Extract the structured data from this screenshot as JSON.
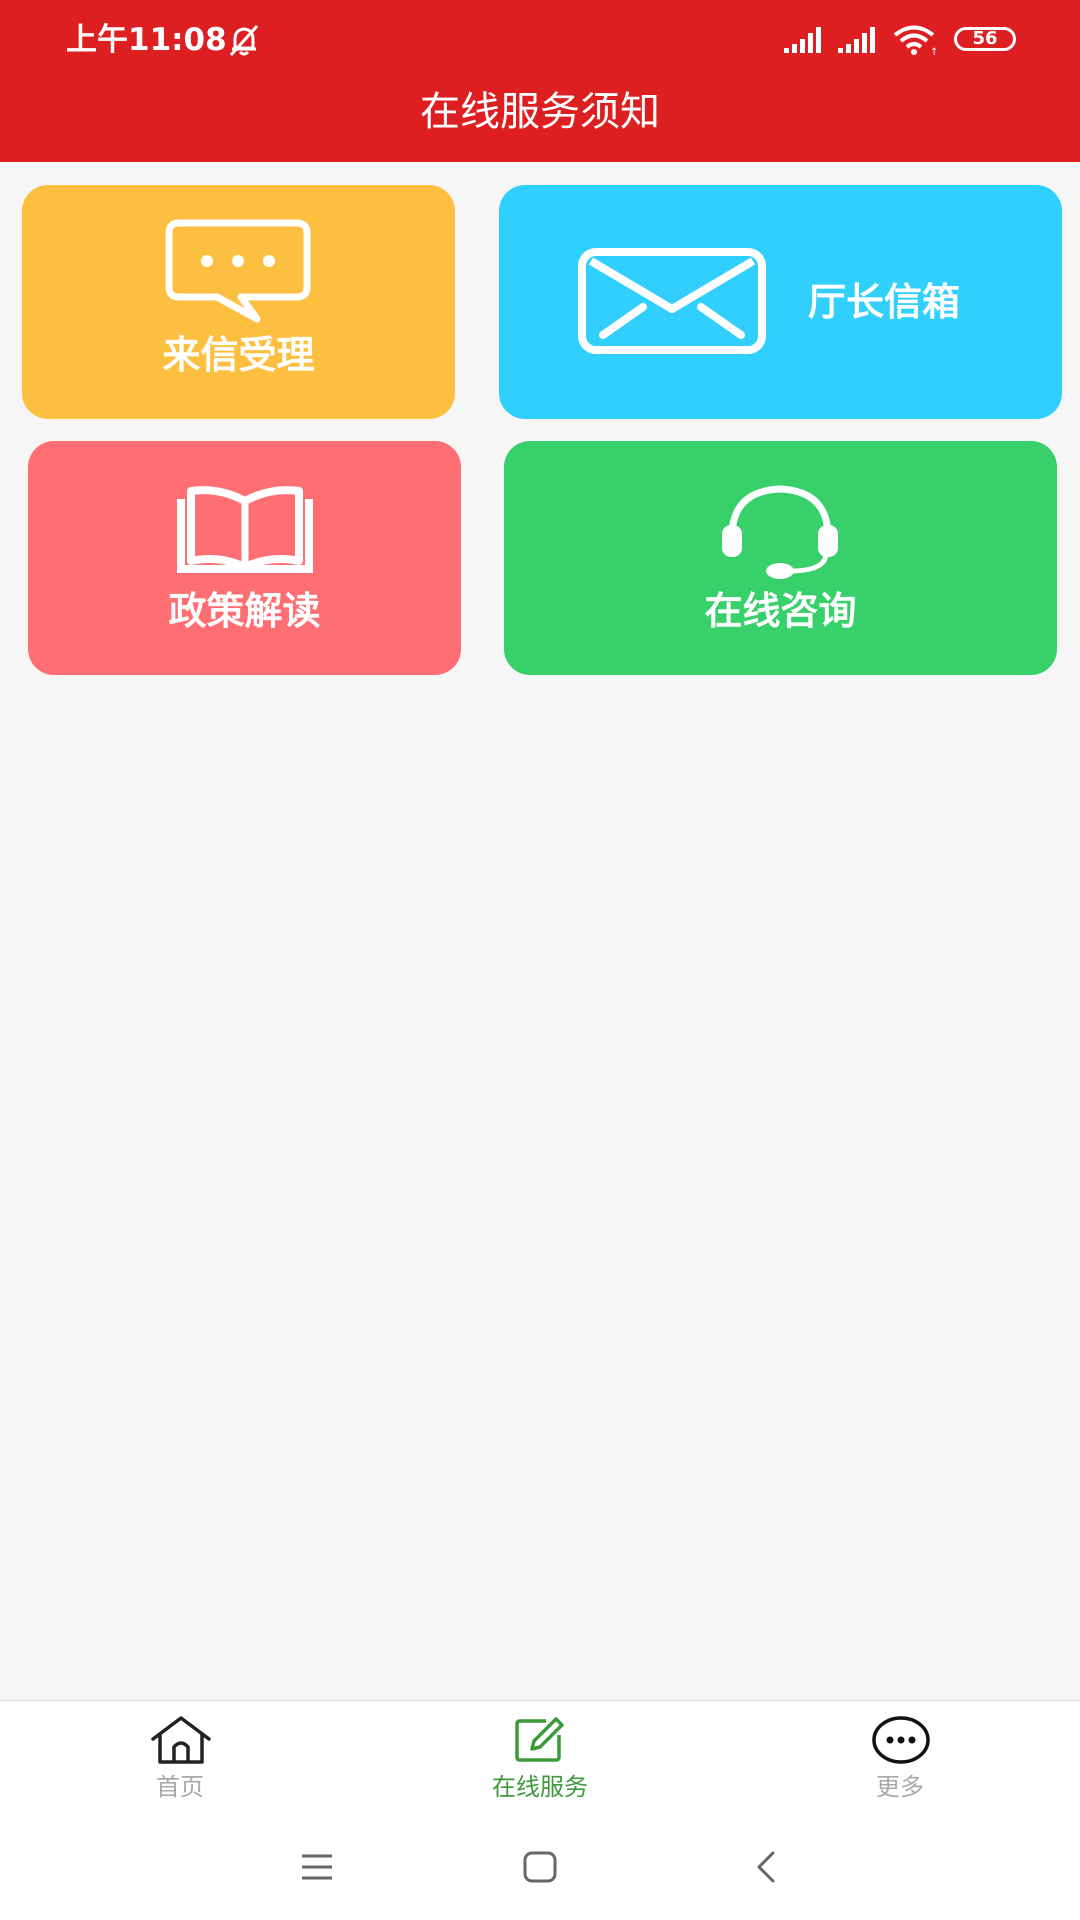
{
  "status_bar": {
    "time": "上午11:08",
    "battery": "56",
    "icons": [
      "bell-off-icon",
      "signal-icon",
      "signal-icon",
      "wifi-icon",
      "battery-icon"
    ]
  },
  "header": {
    "title": "在线服务须知"
  },
  "cards": [
    {
      "label": "来信受理",
      "icon": "chat-bubble-icon",
      "color": "#fdbf3f"
    },
    {
      "label": "厅长信箱",
      "icon": "envelope-icon",
      "color": "#30cffe"
    },
    {
      "label": "政策解读",
      "icon": "open-book-icon",
      "color": "#ff6e73"
    },
    {
      "label": "在线咨询",
      "icon": "headset-icon",
      "color": "#37d06a"
    }
  ],
  "tabs": [
    {
      "label": "首页",
      "icon": "home-icon",
      "active": false
    },
    {
      "label": "在线服务",
      "icon": "edit-icon",
      "active": true
    },
    {
      "label": "更多",
      "icon": "more-icon",
      "active": false
    }
  ],
  "colors": {
    "header_bg": "#dd1f21",
    "page_bg": "#f6f6f6",
    "tab_active": "#3c9a3a",
    "tab_inactive": "#a9a9a9"
  },
  "system_nav": {
    "icons": [
      "menu-icon",
      "home-square-icon",
      "back-icon"
    ]
  }
}
